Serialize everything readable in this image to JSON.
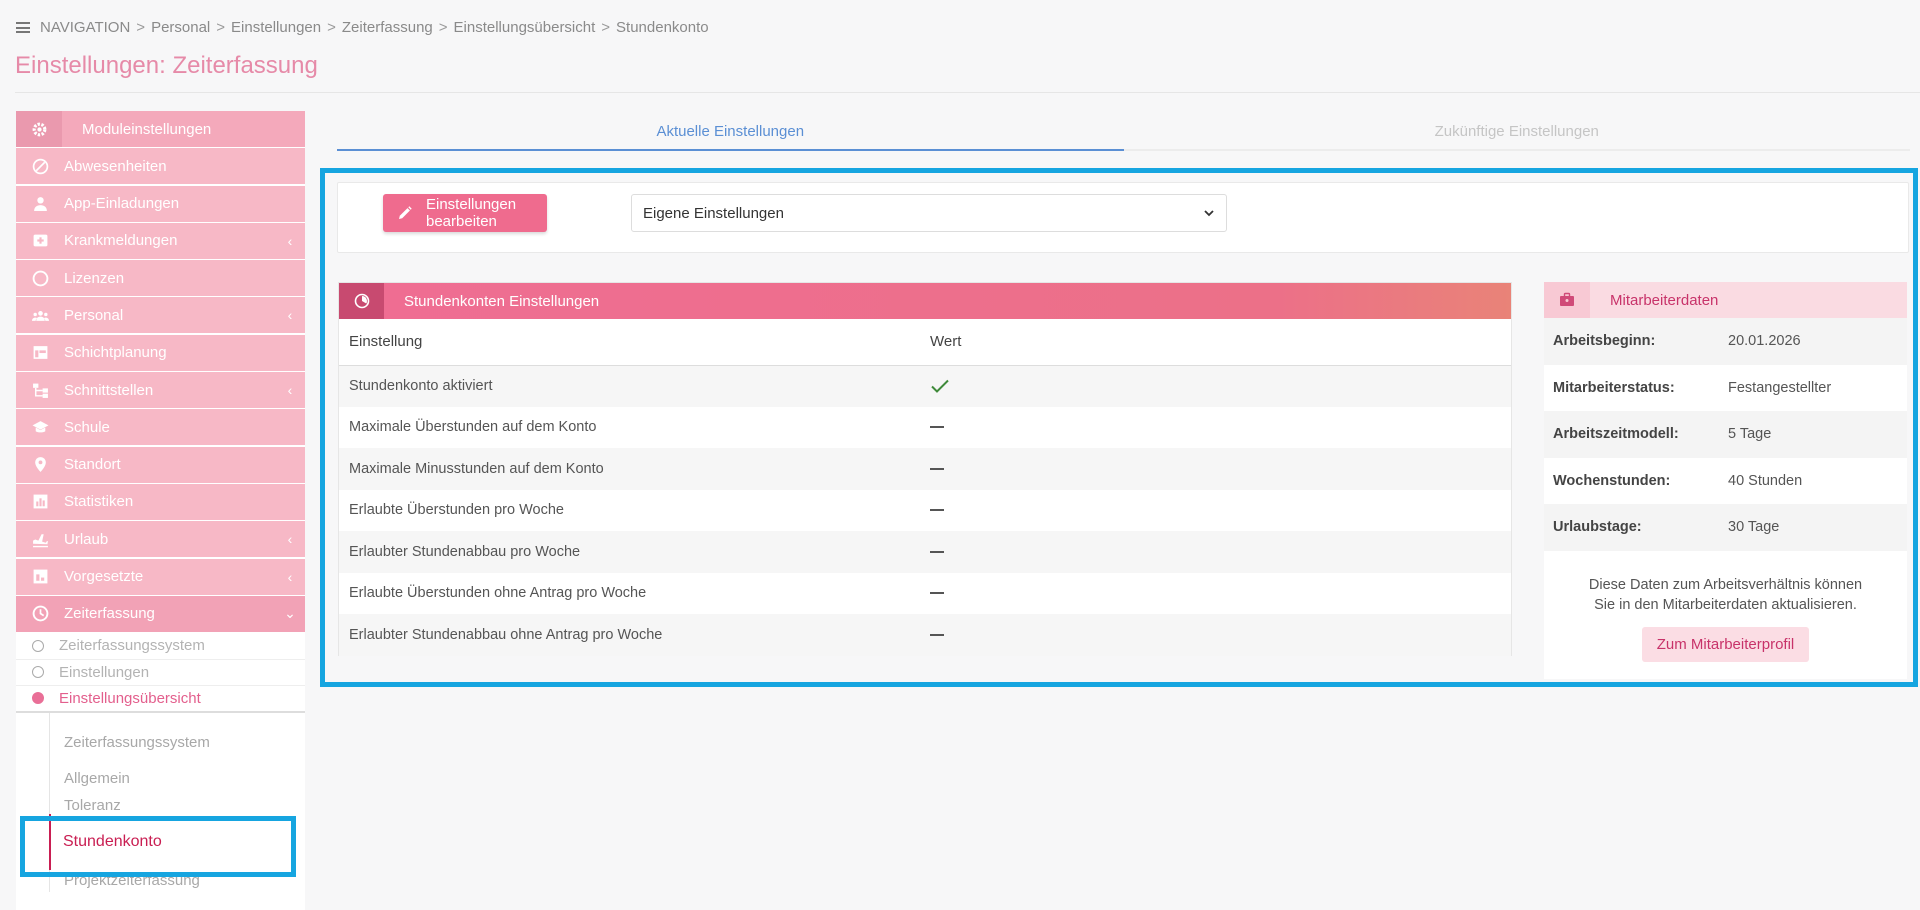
{
  "breadcrumb": {
    "root": "NAVIGATION",
    "items": [
      "Personal",
      "Einstellungen",
      "Zeiterfassung",
      "Einstellungsübersicht",
      "Stundenkonto"
    ],
    "separator": ">"
  },
  "page_title": "Einstellungen: Zeiterfassung",
  "sidebar": {
    "header": "Moduleinstellungen",
    "items": [
      {
        "label": "Abwesenheiten",
        "icon": "ban-icon",
        "chevron": ""
      },
      {
        "label": "App-Einladungen",
        "icon": "user-icon",
        "chevron": ""
      },
      {
        "label": "Krankmeldungen",
        "icon": "medical-icon",
        "chevron": "‹"
      },
      {
        "label": "Lizenzen",
        "icon": "circle-icon",
        "chevron": ""
      },
      {
        "label": "Personal",
        "icon": "people-icon",
        "chevron": "‹"
      },
      {
        "label": "Schichtplanung",
        "icon": "table-icon",
        "chevron": ""
      },
      {
        "label": "Schnittstellen",
        "icon": "sitemap-icon",
        "chevron": "‹"
      },
      {
        "label": "Schule",
        "icon": "graduation-icon",
        "chevron": ""
      },
      {
        "label": "Standort",
        "icon": "map-pin-icon",
        "chevron": ""
      },
      {
        "label": "Statistiken",
        "icon": "bar-chart-icon",
        "chevron": ""
      },
      {
        "label": "Urlaub",
        "icon": "plane-icon",
        "chevron": "‹"
      },
      {
        "label": "Vorgesetzte",
        "icon": "chart-icon",
        "chevron": "‹"
      },
      {
        "label": "Zeiterfassung",
        "icon": "clock-icon",
        "chevron": "⌄"
      }
    ],
    "sub_items": [
      "Zeiterfassungssystem",
      "Einstellungen",
      "Einstellungsübersicht"
    ],
    "sub2_items": [
      "Zeiterfassungssystem",
      "Allgemein",
      "Toleranz",
      "Stundenkonto",
      "Projektzeiterfassung"
    ]
  },
  "tabs": [
    "Aktuelle Einstellungen",
    "Zukünftige Einstellungen"
  ],
  "toolbar": {
    "edit_label": "Einstellungen bearbeiten",
    "select_value": "Eigene Einstellungen"
  },
  "settings_card": {
    "title": "Stundenkonten Einstellungen",
    "col_setting": "Einstellung",
    "col_value": "Wert",
    "rows": [
      {
        "label": "Stundenkonto aktiviert",
        "value": "check"
      },
      {
        "label": "Maximale Überstunden auf dem Konto",
        "value": "dash"
      },
      {
        "label": "Maximale Minusstunden auf dem Konto",
        "value": "dash"
      },
      {
        "label": "Erlaubte Überstunden pro Woche",
        "value": "dash"
      },
      {
        "label": "Erlaubter Stundenabbau pro Woche",
        "value": "dash"
      },
      {
        "label": "Erlaubte Überstunden ohne Antrag pro Woche",
        "value": "dash"
      },
      {
        "label": "Erlaubter Stundenabbau ohne Antrag pro Woche",
        "value": "dash"
      }
    ]
  },
  "employee_card": {
    "title": "Mitarbeiterdaten",
    "rows": [
      {
        "key": "Arbeitsbeginn:",
        "value": "20.01.2026"
      },
      {
        "key": "Mitarbeiterstatus:",
        "value": "Festangestellter"
      },
      {
        "key": "Arbeitszeitmodell:",
        "value": "5 Tage"
      },
      {
        "key": "Wochenstunden:",
        "value": "40 Stunden"
      },
      {
        "key": "Urlaubstage:",
        "value": "30 Tage"
      }
    ],
    "note_line1": "Diese Daten zum Arbeitsverhältnis können",
    "note_line2": "Sie in den Mitarbeiterdaten aktualisieren.",
    "button": "Zum Mitarbeiterprofil"
  },
  "colors": {
    "accent": "#ef6b8e",
    "highlight": "#16a5e0",
    "tab_active": "#5b8fd4"
  }
}
